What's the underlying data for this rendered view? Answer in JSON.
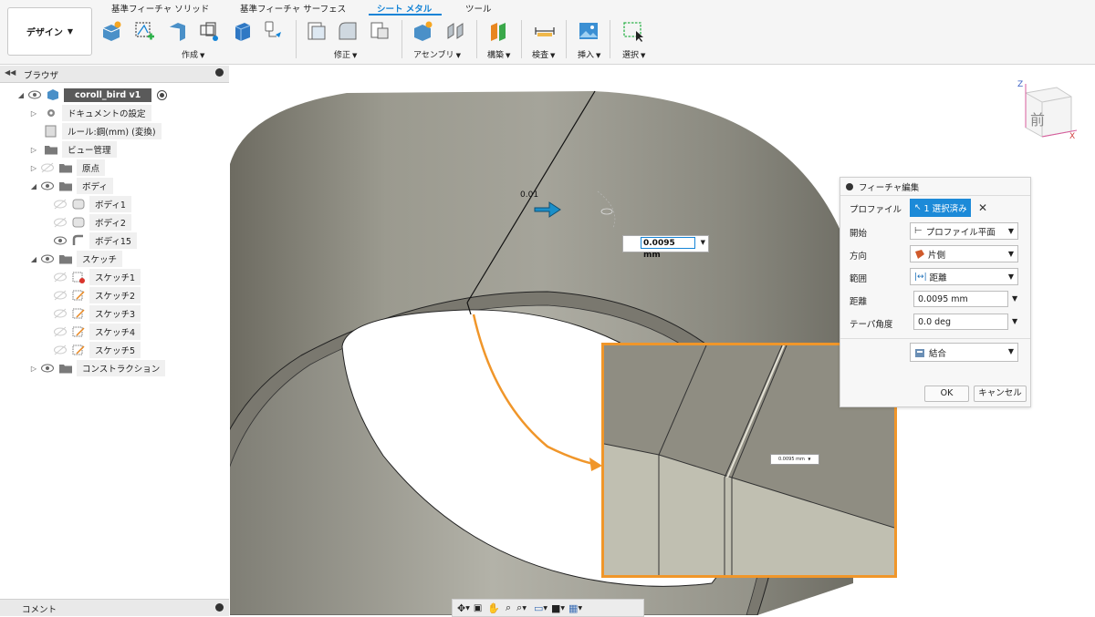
{
  "toolbar": {
    "workspace": "デザイン",
    "tabs": [
      "基準フィーチャ ソリッド",
      "基準フィーチャ サーフェス",
      "シート メタル",
      "ツール"
    ],
    "active_tab": "シート メタル",
    "groups": {
      "create": "作成",
      "modify": "修正",
      "assemble": "アセンブリ",
      "construct": "構築",
      "inspect": "検査",
      "insert": "挿入",
      "select": "選択"
    }
  },
  "browser": {
    "title": "ブラウザ",
    "root": "coroll_bird v1",
    "items": [
      {
        "label": "ドキュメントの設定"
      },
      {
        "label": "ルール:鋼(mm) (変換)"
      },
      {
        "label": "ビュー管理"
      },
      {
        "label": "原点"
      },
      {
        "label": "ボディ"
      },
      {
        "label": "ボディ1"
      },
      {
        "label": "ボディ2"
      },
      {
        "label": "ボディ15"
      },
      {
        "label": "スケッチ"
      },
      {
        "label": "スケッチ1"
      },
      {
        "label": "スケッチ2"
      },
      {
        "label": "スケッチ3"
      },
      {
        "label": "スケッチ4"
      },
      {
        "label": "スケッチ5"
      },
      {
        "label": "コンストラクション"
      }
    ],
    "comment": "コメント"
  },
  "viewport": {
    "dim_label": "0.01",
    "dim_value": "0.0095 mm",
    "inset_dim_value": "0.0095 mm",
    "viewcube_face": "前",
    "viewcube_z": "Z",
    "viewcube_x": "X"
  },
  "feature_panel": {
    "title": "フィーチャ編集",
    "profile_label": "プロファイル",
    "profile_value": "1 選択済み",
    "start_label": "開始",
    "start_value": "プロファイル平面",
    "direction_label": "方向",
    "direction_value": "片側",
    "extent_label": "範囲",
    "extent_value": "距離",
    "distance_label": "距離",
    "distance_value": "0.0095 mm",
    "taper_label": "テーパ角度",
    "taper_value": "0.0 deg",
    "operation_value": "結合",
    "ok": "OK",
    "cancel": "キャンセル"
  },
  "colors": {
    "accent": "#1584d6",
    "highlight_orange": "#f0962a",
    "body_gray": "#8f8d82"
  }
}
